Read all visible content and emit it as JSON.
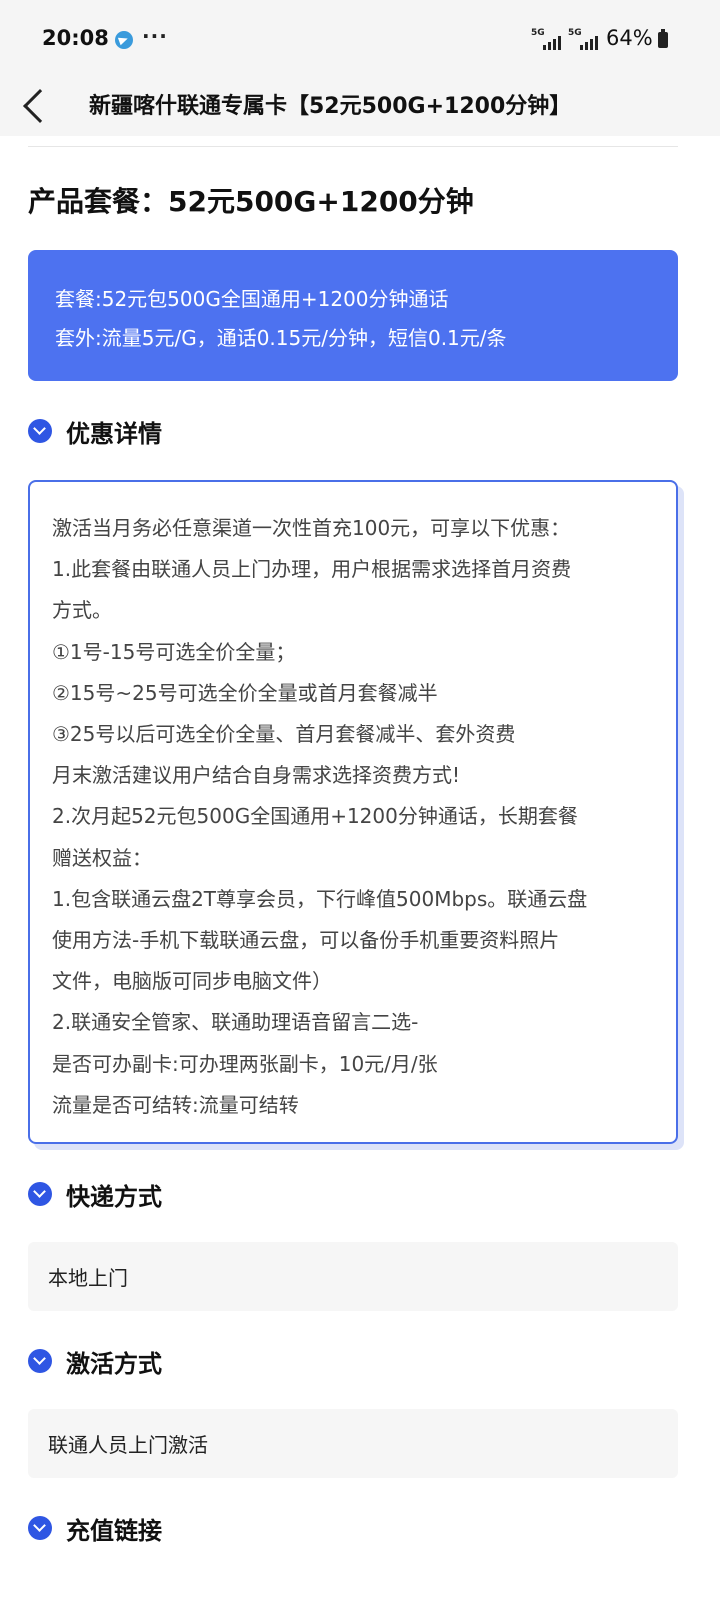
{
  "status_bar": {
    "time": "20:08",
    "more": "···",
    "signal1_label": "5G",
    "signal2_label": "5G",
    "battery": "64%"
  },
  "nav": {
    "title": "新疆喀什联通专属卡【52元500G+1200分钟】"
  },
  "product": {
    "title": "产品套餐：52元500G+1200分钟"
  },
  "plan_box": {
    "line1": "套餐:52元包500G全国通用+1200分钟通话",
    "line2": "套外:流量5元/G，通话0.15元/分钟，短信0.1元/条"
  },
  "sections": {
    "details": {
      "label": "优惠详情",
      "lines": [
        "激活当月务必任意渠道一次性首充100元，可享以下优惠：",
        "1.此套餐由联通人员上门办理，用户根据需求选择首月资费",
        "方式。",
        "①1号-15号可选全价全量；",
        "②15号~25号可选全价全量或首月套餐减半",
        "③25号以后可选全价全量、首月套餐减半、套外资费",
        "月末激活建议用户结合自身需求选择资费方式!",
        "2.次月起52元包500G全国通用+1200分钟通话，长期套餐",
        "赠送权益：",
        "1.包含联通云盘2T尊享会员，下行峰值500Mbps。联通云盘",
        "使用方法-手机下载联通云盘，可以备份手机重要资料照片",
        "文件，电脑版可同步电脑文件）",
        "2.联通安全管家、联通助理语音留言二选-",
        "是否可办副卡:可办理两张副卡，10元/月/张",
        "流量是否可结转:流量可结转"
      ]
    },
    "delivery": {
      "label": "快递方式",
      "value": "本地上门"
    },
    "activation": {
      "label": "激活方式",
      "value": "联通人员上门激活"
    },
    "recharge": {
      "label": "充值链接"
    }
  },
  "icons": {
    "back": "back-chevron-icon",
    "section": "chevron-down-circle-icon",
    "telegram": "telegram-icon",
    "battery": "battery-icon"
  },
  "colors": {
    "accent": "#4d72f0",
    "section_icon": "#2f56e3",
    "detail_border": "#4a6fe8"
  }
}
